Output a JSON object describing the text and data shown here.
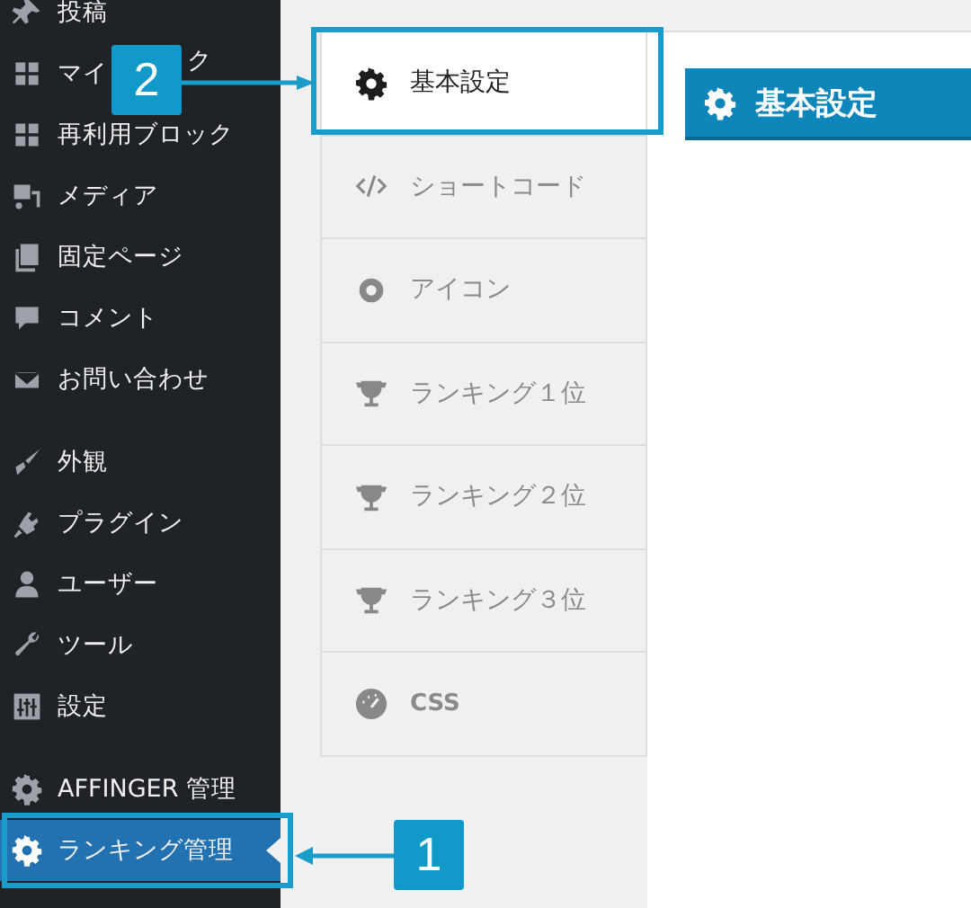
{
  "sidebar": {
    "groups": [
      {
        "items": [
          {
            "label": "投稿",
            "selected": false
          },
          {
            "label": "マイ",
            "label_tail": "ク",
            "selected": false
          },
          {
            "label": "再利用ブロック",
            "selected": false
          },
          {
            "label": "メディア",
            "selected": false
          },
          {
            "label": "固定ページ",
            "selected": false
          },
          {
            "label": "コメント",
            "selected": false
          },
          {
            "label": "お問い合わせ",
            "selected": false
          }
        ]
      },
      {
        "items": [
          {
            "label": "外観",
            "selected": false
          },
          {
            "label": "プラグイン",
            "selected": false
          },
          {
            "label": "ユーザー",
            "selected": false
          },
          {
            "label": "ツール",
            "selected": false
          },
          {
            "label": "設定",
            "selected": false
          }
        ]
      },
      {
        "items": [
          {
            "label": "AFFINGER 管理",
            "selected": false
          },
          {
            "label": "ランキング管理",
            "selected": true
          }
        ]
      }
    ]
  },
  "tabs": [
    {
      "label": "基本設定",
      "selected": true
    },
    {
      "label": "ショートコード",
      "selected": false
    },
    {
      "label": "アイコン",
      "selected": false
    },
    {
      "label": "ランキング１位",
      "selected": false
    },
    {
      "label": "ランキング２位",
      "selected": false
    },
    {
      "label": "ランキング３位",
      "selected": false
    },
    {
      "label": "CSS",
      "selected": false
    }
  ],
  "panel": {
    "heading": "基本設定"
  },
  "annotations": [
    {
      "label": "1"
    },
    {
      "label": "2"
    }
  ]
}
